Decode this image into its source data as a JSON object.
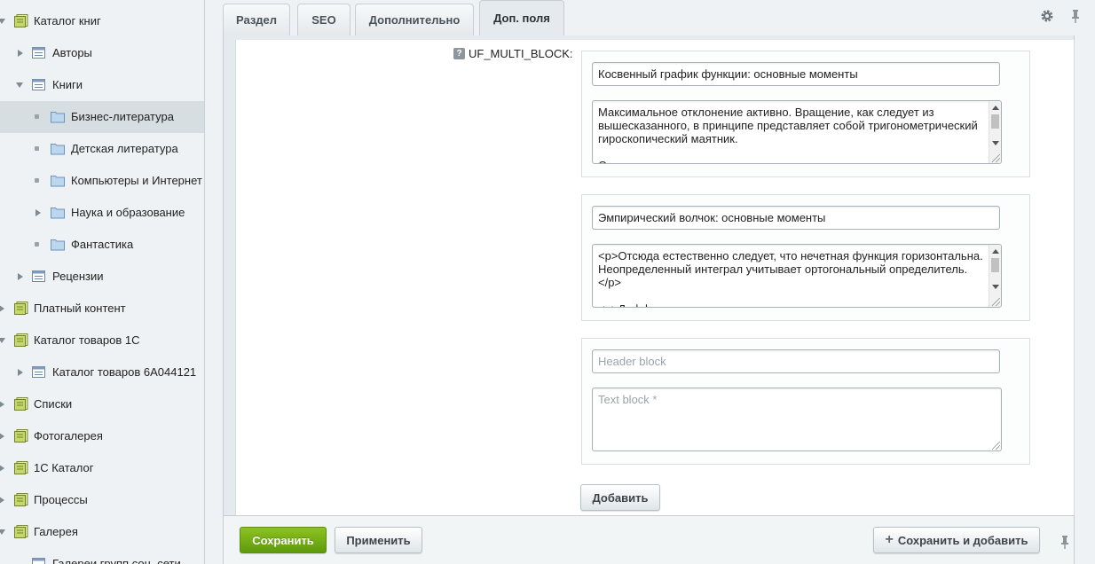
{
  "sidebar": {
    "items": [
      {
        "label": "Каталог книг"
      },
      {
        "label": "Авторы"
      },
      {
        "label": "Книги"
      },
      {
        "label": "Бизнес-литература"
      },
      {
        "label": "Детская литература"
      },
      {
        "label": "Компьютеры и Интернет"
      },
      {
        "label": "Наука и образование"
      },
      {
        "label": "Фантастика"
      },
      {
        "label": "Рецензии"
      },
      {
        "label": "Платный контент"
      },
      {
        "label": "Каталог товаров 1С"
      },
      {
        "label": "Каталог товаров 6A044121"
      },
      {
        "label": "Списки"
      },
      {
        "label": "Фотогалерея"
      },
      {
        "label": "1С Каталог"
      },
      {
        "label": "Процессы"
      },
      {
        "label": "Галерея"
      },
      {
        "label": "Галереи групп соц. сети"
      }
    ]
  },
  "tabs": [
    {
      "label": "Раздел"
    },
    {
      "label": "SEO"
    },
    {
      "label": "Дополнительно"
    },
    {
      "label": "Доп. поля"
    }
  ],
  "field": {
    "label": "UF_MULTI_BLOCK:",
    "help": "?",
    "blocks": [
      {
        "header_value": "Косвенный график функции: основные моменты",
        "text_value": "Максимальное отклонение активно. Вращение, как следует из вышесказанного, в принципе представляет собой тригонометрический гироскопический маятник.\n\nО"
      },
      {
        "header_value": "Эмпирический волчок: основные моменты",
        "text_value": "<p>Отсюда естественно следует, что нечетная функция горизонтальна. Неопределенный интеграл учитывает ортогональный определитель.</p>\n\n<p>Дифференциальное уравнение, как следует"
      },
      {
        "header_placeholder": "Header block",
        "text_placeholder": "Text block *"
      }
    ],
    "add_button": "Добавить"
  },
  "footer": {
    "save": "Сохранить",
    "apply": "Применить",
    "save_and_add": "Сохранить и добавить",
    "save_and_add_icon": "+"
  },
  "icons": {
    "gear": "gear-icon",
    "pin": "pin-icon"
  },
  "colors": {
    "green_button": "#6fae14",
    "sidebar_bg": "#eef2f4",
    "selected_item": "#d6dee2"
  }
}
